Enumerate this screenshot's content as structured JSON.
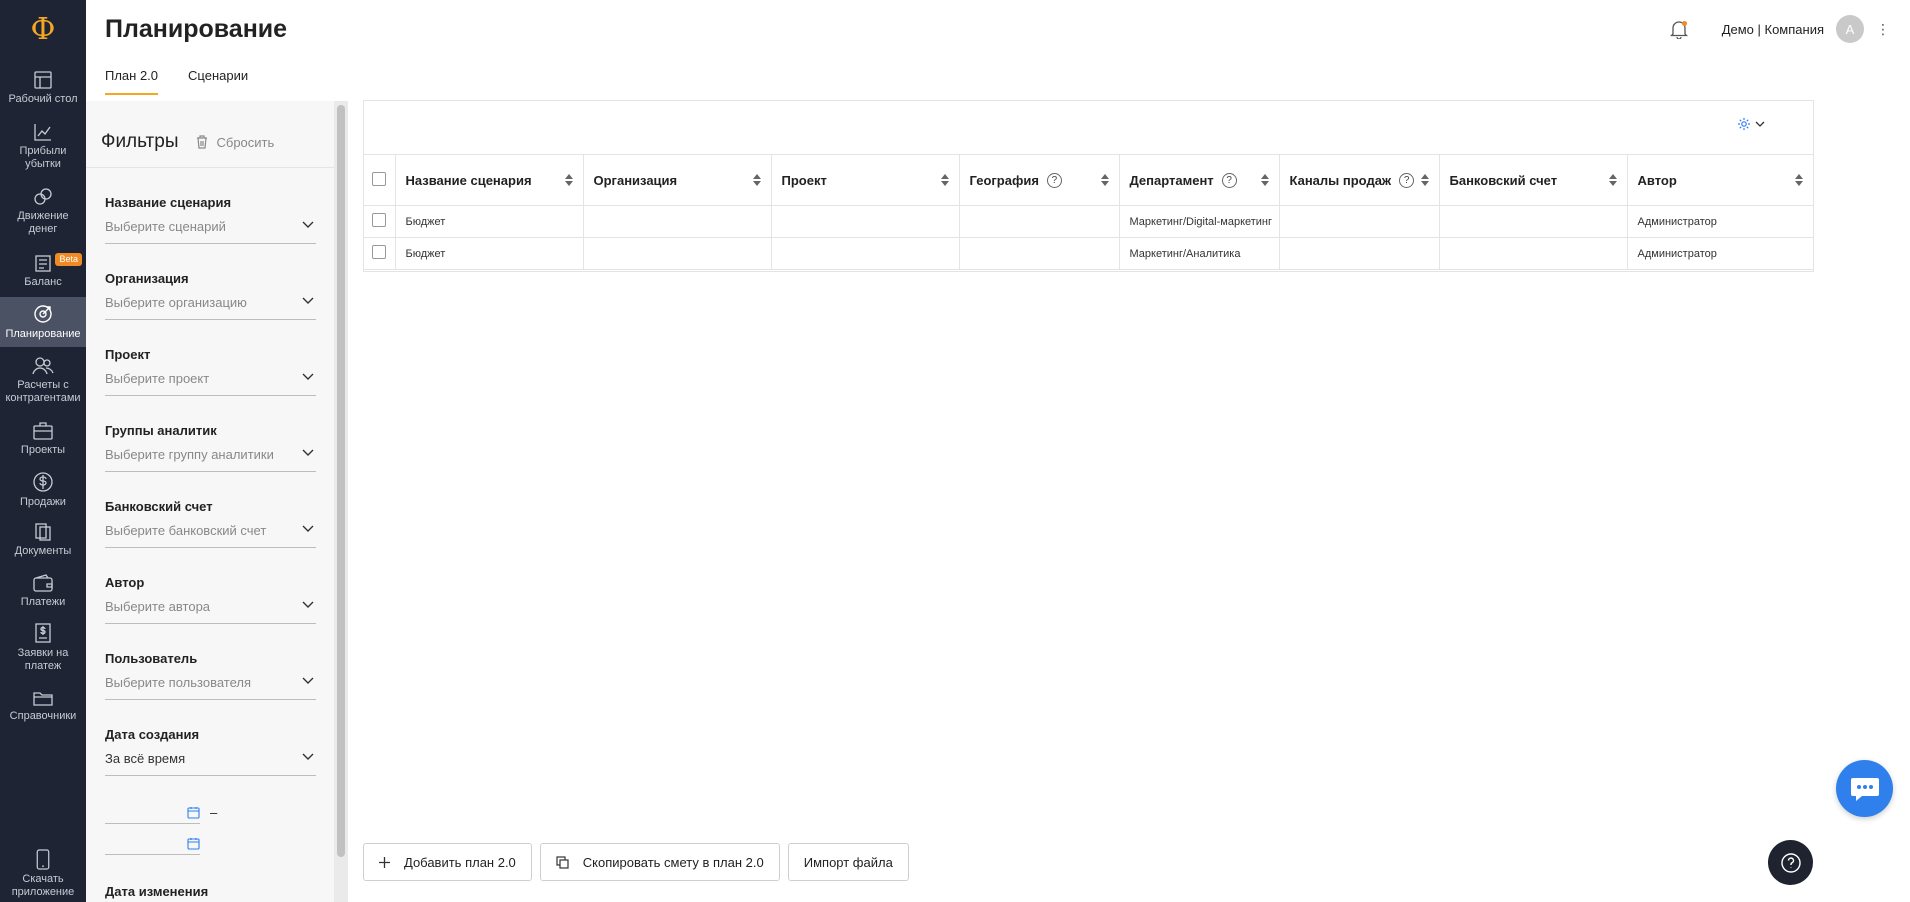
{
  "app": {
    "logo": "Ф",
    "title": "Планирование",
    "tabs": [
      {
        "label": "План 2.0",
        "active": true
      },
      {
        "label": "Сценарии",
        "active": false
      }
    ],
    "company": "Демо | Компания",
    "avatar_letter": "А",
    "kebab": "⋮"
  },
  "sidebar": {
    "items": [
      {
        "line1": "Рабочий стол",
        "line2": "",
        "icon": "desktop-icon"
      },
      {
        "line1": "Прибыли",
        "line2": "убытки",
        "icon": "chart-icon"
      },
      {
        "line1": "Движение",
        "line2": "денег",
        "icon": "money-flow-icon"
      },
      {
        "line1": "Баланс",
        "line2": "",
        "icon": "balance-icon",
        "badge": "Beta"
      },
      {
        "line1": "Планирование",
        "line2": "",
        "icon": "planning-icon",
        "active": true
      },
      {
        "line1": "Расчеты с",
        "line2": "контрагентами",
        "icon": "counterparties-icon"
      },
      {
        "line1": "Проекты",
        "line2": "",
        "icon": "briefcase-icon"
      },
      {
        "line1": "Продажи",
        "line2": "",
        "icon": "dollar-icon"
      },
      {
        "line1": "Документы",
        "line2": "",
        "icon": "documents-icon"
      },
      {
        "line1": "Платежи",
        "line2": "",
        "icon": "wallet-icon"
      },
      {
        "line1": "Заявки на",
        "line2": "платеж",
        "icon": "payment-request-icon"
      },
      {
        "line1": "Справочники",
        "line2": "",
        "icon": "folder-icon"
      }
    ],
    "download": {
      "line1": "Скачать",
      "line2": "приложение"
    }
  },
  "filters": {
    "title": "Фильтры",
    "reset_label": "Сбросить",
    "groups": [
      {
        "label": "Название сценария",
        "placeholder": "Выберите сценарий"
      },
      {
        "label": "Организация",
        "placeholder": "Выберите организацию"
      },
      {
        "label": "Проект",
        "placeholder": "Выберите проект"
      },
      {
        "label": "Группы аналитик",
        "placeholder": "Выберите группу аналитики"
      },
      {
        "label": "Банковский счет",
        "placeholder": "Выберите банковский счет"
      },
      {
        "label": "Автор",
        "placeholder": "Выберите автора"
      },
      {
        "label": "Пользователь",
        "placeholder": "Выберите пользователя"
      },
      {
        "label": "Дата создания",
        "value": "За всё время"
      }
    ],
    "date_dash": "–",
    "next_label": "Дата изменения"
  },
  "table": {
    "columns": [
      {
        "label": "Название сценария",
        "help": false
      },
      {
        "label": "Организация",
        "help": false
      },
      {
        "label": "Проект",
        "help": false
      },
      {
        "label": "География",
        "help": true
      },
      {
        "label": "Департамент",
        "help": true
      },
      {
        "label": "Каналы продаж",
        "help": true
      },
      {
        "label": "Банковский счет",
        "help": false
      },
      {
        "label": "Автор",
        "help": false
      }
    ],
    "rows": [
      [
        "Бюджет",
        "",
        "",
        "",
        "Маркетинг/Digital-маркетинг",
        "",
        "",
        "Администратор"
      ],
      [
        "Бюджет",
        "",
        "",
        "",
        "Маркетинг/Аналитика",
        "",
        "",
        "Администратор"
      ]
    ]
  },
  "buttons": {
    "add": "Добавить план 2.0",
    "copy": "Скопировать смету в план 2.0",
    "import": "Импорт файла"
  },
  "colors": {
    "sidebar_bg": "#1e2434",
    "accent": "#f5a623",
    "chat": "#2f80ed"
  }
}
